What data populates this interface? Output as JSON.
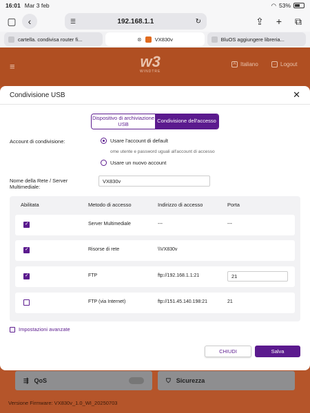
{
  "status": {
    "time": "16:01",
    "date": "Mar 3 feb",
    "battery": "53%"
  },
  "browser": {
    "url": "192.168.1.1",
    "tabs": [
      {
        "label": "cartella. condivisa router fi..."
      },
      {
        "label": "VX830v"
      },
      {
        "label": "BluOS aggiungere libreria..."
      }
    ]
  },
  "router": {
    "brand_logo": "w3",
    "brand_name": "WINDTRE",
    "language": "Italiano",
    "logout": "Logout",
    "cards": [
      {
        "label": "QoS"
      },
      {
        "label": "Sicurezza"
      }
    ],
    "firmware": "Versione Firmware: VX830v_1.0_WI_20250703"
  },
  "modal": {
    "title": "Condivisione USB",
    "segments": [
      {
        "label": "Dispositivo di archiviazione USB",
        "active": false
      },
      {
        "label": "Condivisione dell'accesso",
        "active": true
      }
    ],
    "account_label": "Account di condivisione:",
    "radio_default": "Usare l'account di default",
    "radio_default_hint": "ome utente e password uguali all'account di accesso",
    "radio_new": "Usare un nuovo account",
    "network_name_label": "Nome della Rete / Server Multimediale:",
    "network_name_value": "VX830v",
    "table": {
      "headers": [
        "Abilitata",
        "Metodo di accesso",
        "Indirizzo di accesso",
        "Porta"
      ],
      "rows": [
        {
          "enabled": true,
          "method": "Server Multimediale",
          "address": "---",
          "port": "---"
        },
        {
          "enabled": true,
          "method": "Risorse di rete",
          "address": "\\\\VX830v",
          "port": ""
        },
        {
          "enabled": true,
          "method": "FTP",
          "address": "ftp://192.168.1.1:21",
          "port": "21"
        },
        {
          "enabled": false,
          "method": "FTP (via Internet)",
          "address": "ftp://151.45.140.198:21",
          "port": "21"
        }
      ]
    },
    "advanced_link": "Impostazioni avanzate",
    "close_button": "CHIUDI",
    "save_button": "Salva"
  },
  "colors": {
    "accent": "#5b1a8e",
    "brand_bg": "#b5552a"
  }
}
